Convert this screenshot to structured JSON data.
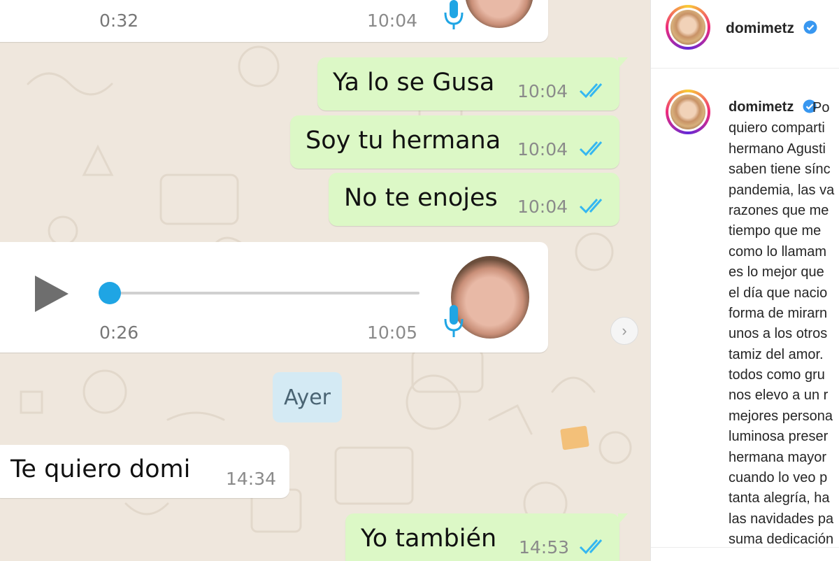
{
  "whatsapp": {
    "voice_note_top": {
      "duration": "0:32",
      "time": "10:04"
    },
    "messages_out_1": [
      {
        "text": "Ya lo se Gusa",
        "time": "10:04"
      },
      {
        "text": "Soy tu hermana",
        "time": "10:04"
      },
      {
        "text": "No te enojes",
        "time": "10:04"
      }
    ],
    "voice_note": {
      "duration": "0:26",
      "time": "10:05",
      "progress": 0
    },
    "day_separator": "Ayer",
    "message_in": {
      "text": "Te quiero domi",
      "time": "14:34"
    },
    "message_out_last": {
      "text": "Yo también",
      "time": "14:53"
    },
    "colors": {
      "outgoing": "#dcf8c6",
      "incoming": "#ffffff",
      "ticks": "#34b7f1",
      "background": "#efe7dd"
    }
  },
  "instagram": {
    "username": "domimetz",
    "verified": true,
    "caption_username": "domimetz",
    "caption_lines": [
      "Po",
      "quiero comparti",
      "hermano Agusti",
      "saben tiene sínc",
      "pandemia, las va",
      "razones que me",
      "tiempo que me",
      "como lo llamam",
      "es lo mejor que",
      "el día que nacio",
      "forma de mirarn",
      "unos a los otros",
      "tamiz del amor.",
      "todos como gru",
      "nos elevo a un r",
      "mejores persona",
      "luminosa preser",
      "hermana mayor",
      "cuando lo veo p",
      "tanta alegría, ha",
      "las navidades pa",
      "suma dedicación"
    ]
  }
}
